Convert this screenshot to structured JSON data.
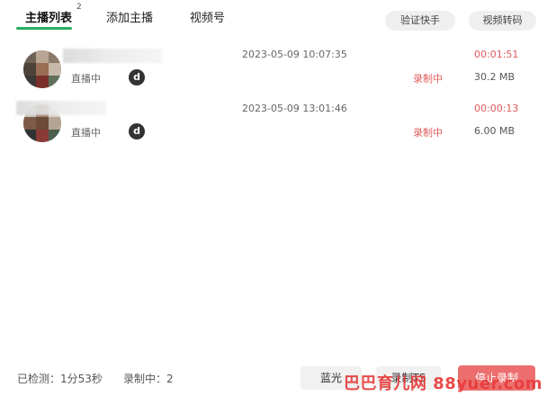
{
  "tabs": [
    {
      "label": "主播列表",
      "badge": "2"
    },
    {
      "label": "添加主播"
    },
    {
      "label": "视频号"
    }
  ],
  "header_buttons": {
    "verify": "验证快手",
    "transcode": "视频转码"
  },
  "streamers": [
    {
      "status": "直播中",
      "platform_icon": "d",
      "time": "2023-05-09 10:07:35",
      "record_status": "",
      "duration": "00:01:51",
      "size": "30.2 MB"
    },
    {
      "status": "直播中",
      "platform_icon": "d",
      "time": "2023-05-09 13:01:46",
      "record_status": "录制中",
      "duration": "00:00:13",
      "size": "6.00 MB"
    }
  ],
  "streamer1_record_status": "录制中",
  "footer": {
    "detected": "已检测：1分53秒",
    "recording": "录制中：2",
    "btn_quality": "蓝光",
    "btn_ts": "录制TS",
    "btn_stop": "停止录制"
  },
  "watermark": "巴巴育儿网 88yuer.com",
  "colors": {
    "accent_green": "#27ae60",
    "recording_red": "#e05a5a",
    "stop_button": "#ec6e6e"
  }
}
